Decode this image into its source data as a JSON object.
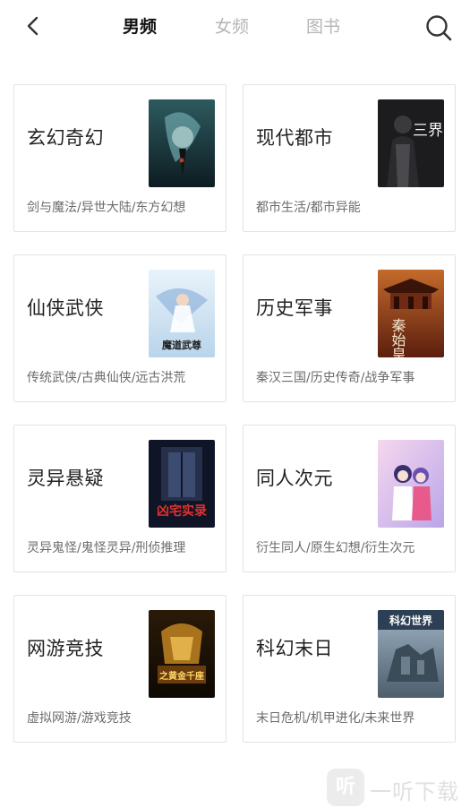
{
  "header": {
    "tabs": [
      {
        "label": "男频",
        "active": true
      },
      {
        "label": "女频",
        "active": false
      },
      {
        "label": "图书",
        "active": false
      }
    ],
    "back_icon": "chevron-left-icon",
    "search_icon": "search-icon"
  },
  "categories": [
    {
      "title": "玄幻奇幻",
      "tags": "剑与魔法/异世大陆/东方幻想"
    },
    {
      "title": "现代都市",
      "tags": "都市生活/都市异能",
      "cover_text": "三界"
    },
    {
      "title": "仙侠武侠",
      "tags": "传统武侠/古典仙侠/远古洪荒",
      "cover_text": "魔道武尊"
    },
    {
      "title": "历史军事",
      "tags": "秦汉三国/历史传奇/战争军事",
      "cover_text": "秦始皇"
    },
    {
      "title": "灵异悬疑",
      "tags": "灵异鬼怪/鬼怪灵异/刑侦推理",
      "cover_text": "凶宅实录"
    },
    {
      "title": "同人次元",
      "tags": "衍生同人/原生幻想/衍生次元"
    },
    {
      "title": "网游竞技",
      "tags": "虚拟网游/游戏竞技",
      "cover_text": "之黄金千座"
    },
    {
      "title": "科幻末日",
      "tags": "末日危机/机甲进化/未来世界",
      "cover_text": "科幻世界"
    }
  ],
  "watermark": {
    "badge": "听",
    "text": "一听下载"
  },
  "colors": {
    "active_tab": "#111111",
    "inactive_tab": "#b5b5b5",
    "card_border": "#e3e3e3",
    "tag_text": "#6b6b6b"
  }
}
